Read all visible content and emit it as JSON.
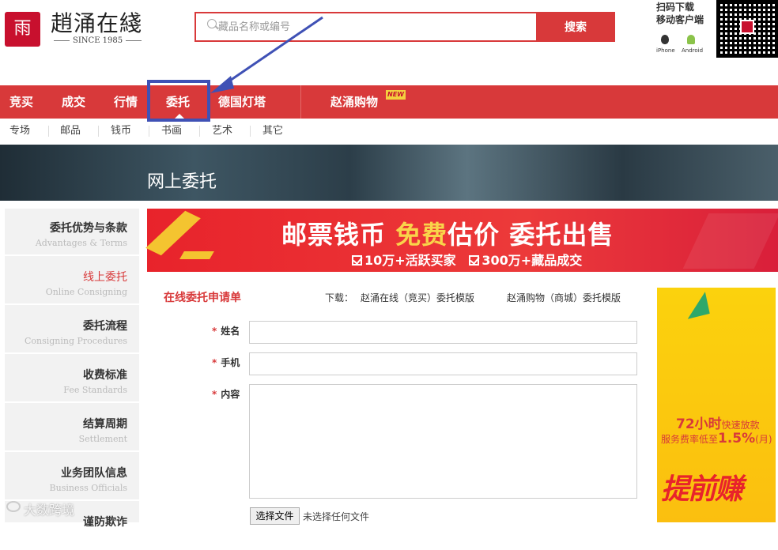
{
  "header": {
    "logo_mark": "雨",
    "logo_name": "趙涌在綫",
    "logo_since": "SINCE 1985",
    "search_placeholder": "藏品名称或编号",
    "search_button": "搜索",
    "app_line1": "扫码下载",
    "app_line2": "移动客户端",
    "app_iphone": "iPhone",
    "app_android": "Android"
  },
  "main_nav": {
    "items": [
      "竞买",
      "成交",
      "行情",
      "委托",
      "德国灯塔",
      "赵涌购物"
    ],
    "new_badge": "NEW",
    "active": "委托"
  },
  "sub_nav": {
    "items": [
      "专场",
      "邮品",
      "钱币",
      "书画",
      "艺术",
      "其它"
    ]
  },
  "banner": {
    "title": "网上委托"
  },
  "sidebar": {
    "items": [
      {
        "cn": "委托优势与条款",
        "en": "Advantages & Terms"
      },
      {
        "cn": "线上委托",
        "en": "Online Consigning"
      },
      {
        "cn": "委托流程",
        "en": "Consigning Procedures"
      },
      {
        "cn": "收费标准",
        "en": "Fee Standards"
      },
      {
        "cn": "结算周期",
        "en": "Settlement"
      },
      {
        "cn": "业务团队信息",
        "en": "Business Officials"
      },
      {
        "cn": "谨防欺诈",
        "en": ""
      }
    ],
    "active_index": 1
  },
  "promo": {
    "headline_a": "邮票钱币 ",
    "headline_b": "免费",
    "headline_c": "估价 委托出售",
    "sub_1": "10万+活跃买家",
    "sub_2": "300万+藏品成交"
  },
  "form": {
    "title": "在线委托申请单",
    "download_label": "下载：",
    "download_link1": "赵涌在线（竞买）委托模版",
    "download_link2": "赵涌购物（商城）委托模版",
    "fields": [
      {
        "label": "姓名",
        "value": ""
      },
      {
        "label": "手机",
        "value": ""
      },
      {
        "label": "内容",
        "value": ""
      }
    ],
    "file_button": "选择文件",
    "file_status": "未选择任何文件"
  },
  "side_ad": {
    "line1_big": "72小时",
    "line1_small": "快速放款",
    "line2_small": "服务费率低至",
    "line2_big": "1.5%",
    "line2_suffix": "(月)",
    "line3": "提前赚"
  },
  "watermark": {
    "text": "大数跨境"
  },
  "colors": {
    "brand_red": "#d8393a",
    "highlight_blue": "#3f51b5",
    "ad_yellow": "#fbd20d"
  }
}
